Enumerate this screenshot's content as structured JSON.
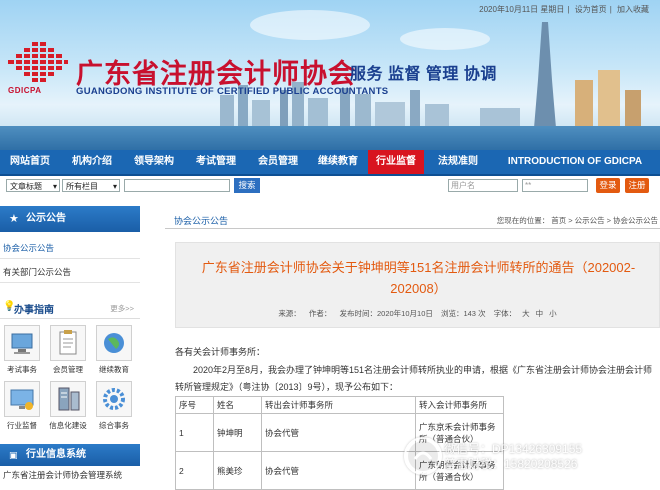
{
  "top_links": {
    "date": "2020年10月11日 星期日",
    "set_home": "设为首页",
    "favorite": "加入收藏"
  },
  "header": {
    "logo_abbr": "GDICPA",
    "org_name_cn": "广东省注册会计师协会",
    "org_name_en": "GUANGDONG INSTITUTE OF CERTIFIED PUBLIC ACCOUNTANTS",
    "slogan": "服务 监督 管理 协调"
  },
  "nav": {
    "items": [
      {
        "label": "网站首页"
      },
      {
        "label": "机构介绍"
      },
      {
        "label": "领导架构"
      },
      {
        "label": "考试管理"
      },
      {
        "label": "会员管理"
      },
      {
        "label": "继续教育"
      },
      {
        "label": "行业监督"
      },
      {
        "label": "法规准则"
      },
      {
        "label": "INTRODUCTION OF GDICPA"
      }
    ],
    "active_color": "#d8141f",
    "bar_color": "#1b67b3"
  },
  "search": {
    "select1": "文章标题",
    "select2": "所有栏目",
    "button": "搜索",
    "username_placeholder": "用户名",
    "password_placeholder": "**",
    "login": "登录",
    "register": "注册"
  },
  "sidebar": {
    "notice_head": "公示公告",
    "notice_links": [
      "协会公示公告",
      "有关部门公示公告"
    ],
    "guide_head": "办事指南",
    "guide_more": "更多>>",
    "guides": [
      {
        "label": "考试事务",
        "icon": "computer-icon"
      },
      {
        "label": "会员管理",
        "icon": "clipboard-icon"
      },
      {
        "label": "继续教育",
        "icon": "globe-icon"
      },
      {
        "label": "行业监督",
        "icon": "monitor-icon"
      },
      {
        "label": "信息化建设",
        "icon": "server-icon"
      },
      {
        "label": "综合事务",
        "icon": "gear-icon"
      }
    ],
    "industry_head": "行业信息系统",
    "industry_first": "广东省注册会计师协会管理系统"
  },
  "main": {
    "section_title": "协会公示公告",
    "breadcrumb": {
      "prefix": "您现在的位置：",
      "home": "首页",
      "sep": ">",
      "c1": "公示公告",
      "c2": "协会公示公告"
    },
    "article": {
      "title": "广东省注册会计师协会关于钟坤明等151名注册会计师转所的通告（202002-202008）",
      "meta": {
        "source": "来源：",
        "author": "作者：",
        "published": "发布时间：2020年10月10日",
        "views": "浏览：143 次",
        "font": "字体：",
        "font_big": "大",
        "font_mid": "中",
        "font_small": "小"
      },
      "p1": "各有关会计师事务所：",
      "p2": "2020年2月至8月，我会办理了钟坤明等151名注册会计师转所执业的申请，根据《广东省注册会计师协会注册会计师转所管理规定》（粤注协〔2013〕9号），现予公布如下："
    },
    "table": {
      "headers": [
        "序号",
        "姓名",
        "转出会计师事务所",
        "转入会计师事务所"
      ],
      "rows": [
        [
          "1",
          "钟坤明",
          "协会代管",
          "广东京禾会计师事务所（普通合伙）"
        ],
        [
          "2",
          "熊美珍",
          "协会代管",
          "广东朗信会计师事务所（普通合伙）"
        ]
      ]
    }
  },
  "watermark": {
    "line1": "微信号：DP13426309155",
    "line2": "普惠财税：15820208526"
  }
}
